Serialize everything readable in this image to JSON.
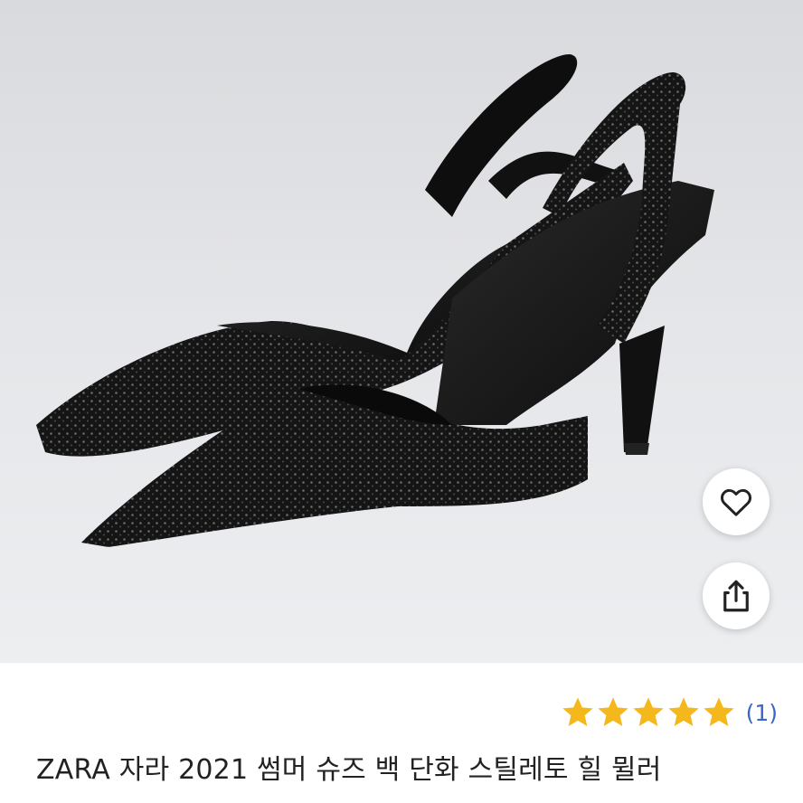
{
  "product": {
    "image_alt": "black rhinestone slingback stiletto pumps",
    "title": "ZARA 자라 2021 썸머 슈즈 백 단화 스틸레토 힐 뮐러",
    "rating": {
      "stars": 5,
      "max": 5,
      "count_label": "(1)"
    }
  },
  "actions": {
    "like_icon": "heart-icon",
    "share_icon": "share-icon"
  },
  "colors": {
    "star": "#f5b81c",
    "count": "#3a66c8",
    "title": "#222222",
    "shoe": "#141414"
  }
}
